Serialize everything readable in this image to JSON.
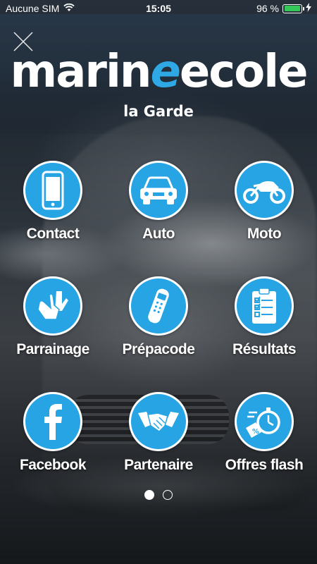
{
  "status_bar": {
    "carrier": "Aucune SIM",
    "time": "15:05",
    "battery": "96 %",
    "battery_level": 0.96,
    "icons": [
      "wifi-icon",
      "battery-icon",
      "charging-icon"
    ]
  },
  "logo": {
    "brand_part1": "marin",
    "brand_part2": "e",
    "brand_part3": "ecole",
    "subtitle": "la Garde",
    "accent_color": "#2fa8e6"
  },
  "tiles": [
    {
      "label": "Contact",
      "icon": "smartphone-icon"
    },
    {
      "label": "Auto",
      "icon": "car-icon"
    },
    {
      "label": "Moto",
      "icon": "motorcycle-icon"
    },
    {
      "label": "Parrainage",
      "icon": "hands-icon"
    },
    {
      "label": "Prépacode",
      "icon": "remote-control-icon"
    },
    {
      "label": "Résultats",
      "icon": "clipboard-checklist-icon"
    },
    {
      "label": "Facebook",
      "icon": "facebook-icon"
    },
    {
      "label": "Partenaire",
      "icon": "handshake-icon"
    },
    {
      "label": "Offres flash",
      "icon": "stopwatch-discount-icon"
    }
  ],
  "pagination": {
    "current": 1,
    "total": 2
  },
  "colors": {
    "tile_fill": "#26a4e4",
    "tile_border": "#ffffff"
  }
}
